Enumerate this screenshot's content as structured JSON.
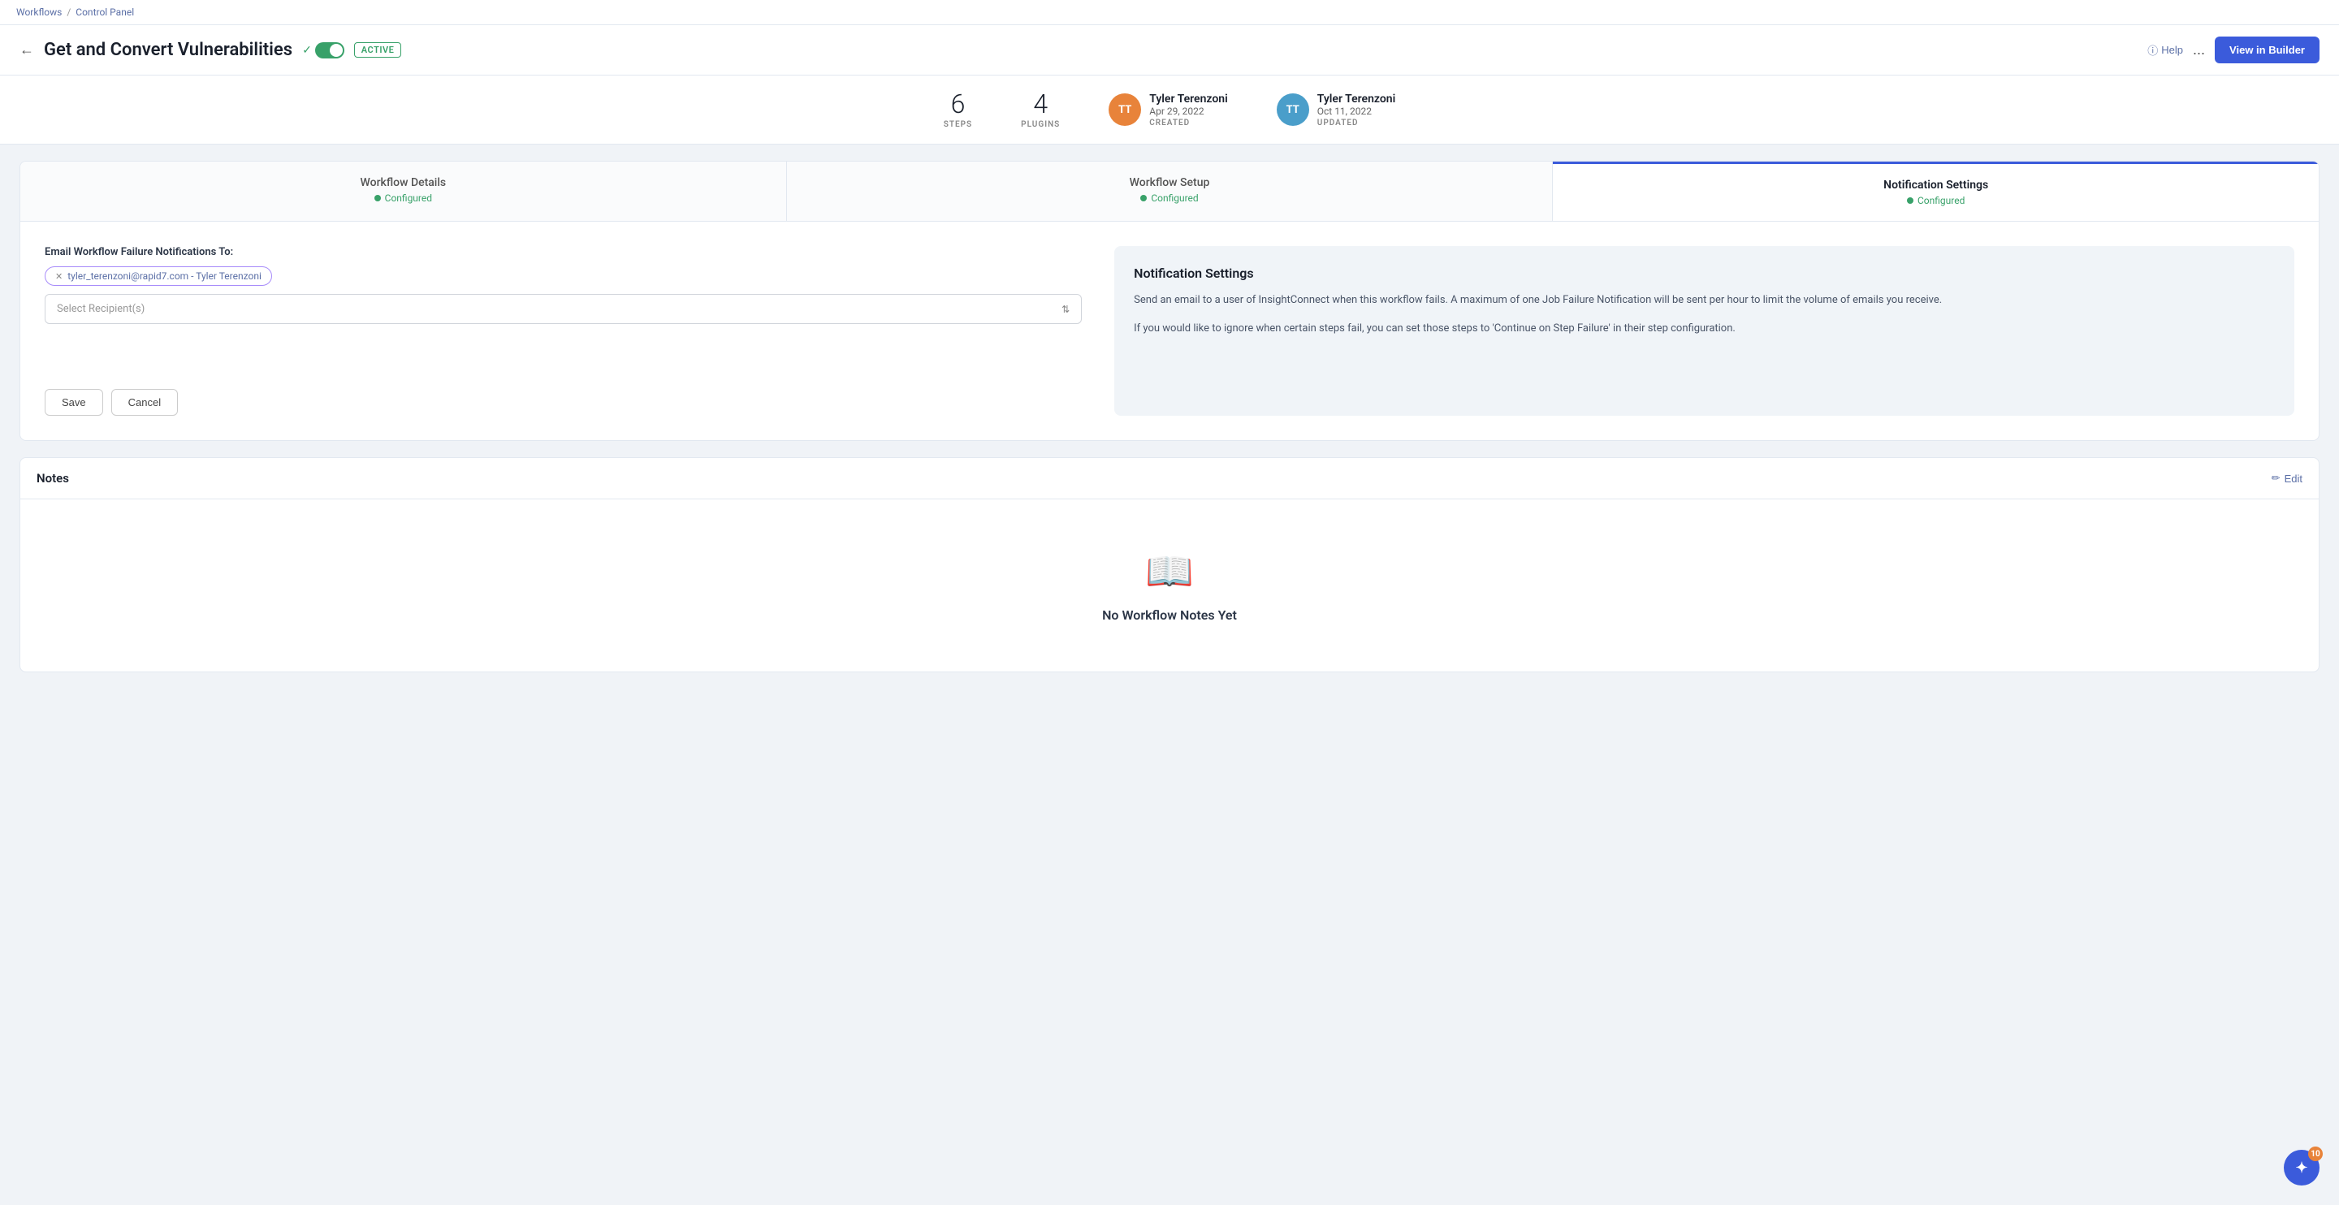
{
  "breadcrumb": {
    "workflows_label": "Workflows",
    "separator": "/",
    "control_panel_label": "Control Panel"
  },
  "header": {
    "title": "Get and Convert Vulnerabilities",
    "toggle_active": true,
    "active_badge": "ACTIVE",
    "help_label": "Help",
    "more_label": "...",
    "view_builder_label": "View in Builder"
  },
  "stats": {
    "steps": {
      "count": "6",
      "label": "STEPS"
    },
    "plugins": {
      "count": "4",
      "label": "PLUGINS"
    },
    "created": {
      "initials": "TT",
      "name": "Tyler Terenzoni",
      "date": "Apr 29, 2022",
      "label": "CREATED"
    },
    "updated": {
      "initials": "TT",
      "name": "Tyler Terenzoni",
      "date": "Oct 11, 2022",
      "label": "UPDATED"
    }
  },
  "tabs": [
    {
      "id": "workflow-details",
      "title": "Workflow Details",
      "status": "Configured",
      "active": false
    },
    {
      "id": "workflow-setup",
      "title": "Workflow Setup",
      "status": "Configured",
      "active": false
    },
    {
      "id": "notification-settings",
      "title": "Notification Settings",
      "status": "Configured",
      "active": true
    }
  ],
  "notification_settings": {
    "form": {
      "label": "Email Workflow Failure Notifications To:",
      "email_tag": "tyler_terenzoni@rapid7.com - Tyler Terenzoni",
      "select_placeholder": "Select Recipient(s)",
      "save_label": "Save",
      "cancel_label": "Cancel"
    },
    "info_panel": {
      "title": "Notification Settings",
      "text1": "Send an email to a user of InsightConnect when this workflow fails. A maximum of one Job Failure Notification will be sent per hour to limit the volume of emails you receive.",
      "text2": "If you would like to ignore when certain steps fail, you can set those steps to 'Continue on Step Failure' in their step configuration."
    }
  },
  "notes": {
    "title": "Notes",
    "edit_label": "Edit",
    "empty_title": "No Workflow Notes Yet"
  },
  "floating": {
    "count": "10"
  }
}
